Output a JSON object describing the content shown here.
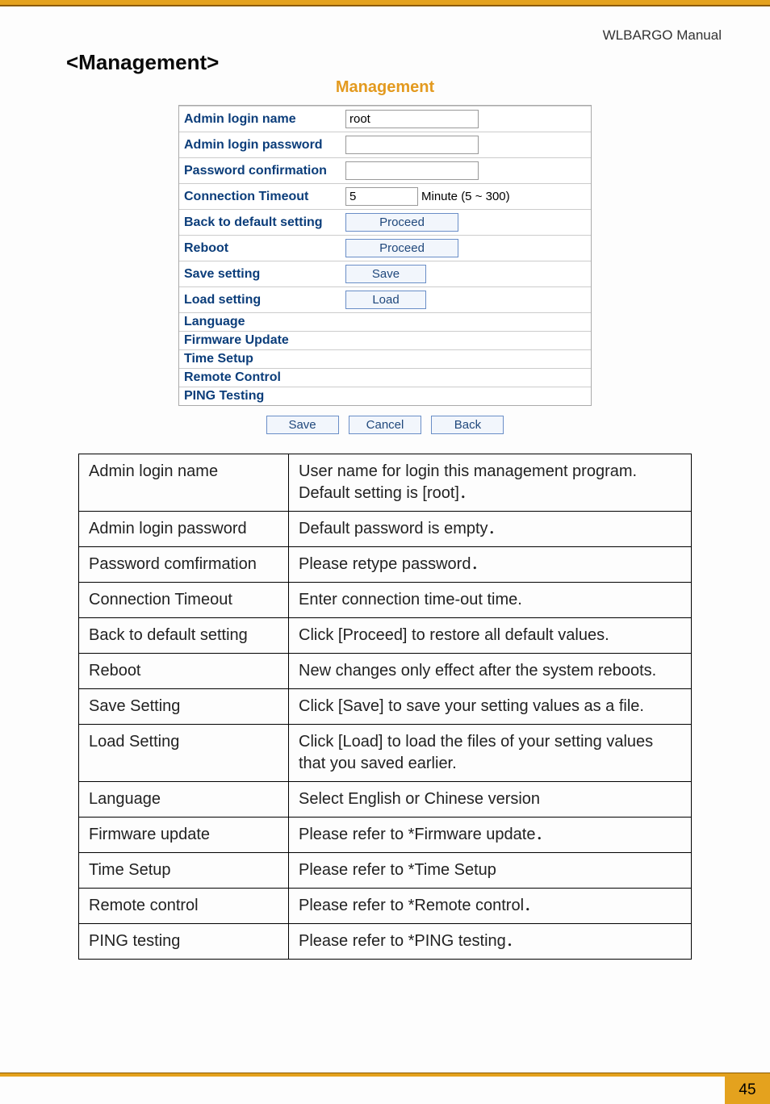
{
  "header": {
    "manual": "WLBARGO Manual"
  },
  "section_title": "<Management>",
  "shot": {
    "title": "Management",
    "rows": {
      "login_name": {
        "label": "Admin login name",
        "value": "root"
      },
      "login_pw": {
        "label": "Admin login password",
        "value": ""
      },
      "pw_conf": {
        "label": "Password confirmation",
        "value": ""
      },
      "timeout": {
        "label": "Connection Timeout",
        "value": "5",
        "unit": "Minute (5 ~ 300)"
      },
      "default": {
        "label": "Back to default setting",
        "btn": "Proceed"
      },
      "reboot": {
        "label": "Reboot",
        "btn": "Proceed"
      },
      "savesetting": {
        "label": "Save setting",
        "btn": "Save"
      },
      "loadsetting": {
        "label": "Load setting",
        "btn": "Load"
      }
    },
    "links": [
      "Language",
      "Firmware Update",
      "Time Setup",
      "Remote Control",
      "PING Testing"
    ],
    "bottom_buttons": [
      "Save",
      "Cancel",
      "Back"
    ]
  },
  "desc": [
    {
      "k": "Admin login name",
      "v": "User name for login this management program. Default setting is [root]．"
    },
    {
      "k": "Admin login password",
      "v": "Default password is empty．"
    },
    {
      "k": "Password comfirmation",
      "v": "Please retype password．"
    },
    {
      "k": "Connection Timeout",
      "v": "Enter connection time-out time."
    },
    {
      "k": "Back to default setting",
      "v": "Click [Proceed] to restore all default values."
    },
    {
      "k": "Reboot",
      "v": "New changes only effect after the system reboots."
    },
    {
      "k": "Save Setting",
      "v": "Click [Save] to save your setting values as a file."
    },
    {
      "k": "Load Setting",
      "v": "Click [Load] to load the files of your setting values that you saved earlier."
    },
    {
      "k": "Language",
      "v": "Select English or Chinese version"
    },
    {
      "k": "Firmware update",
      "v": "Please refer to *Firmware update．"
    },
    {
      "k": "Time Setup",
      "v": "Please refer to *Time Setup"
    },
    {
      "k": "Remote control",
      "v": "Please refer to *Remote control．"
    },
    {
      "k": "PING testing",
      "v": "Please refer to *PING testing．"
    }
  ],
  "page_number": "45"
}
